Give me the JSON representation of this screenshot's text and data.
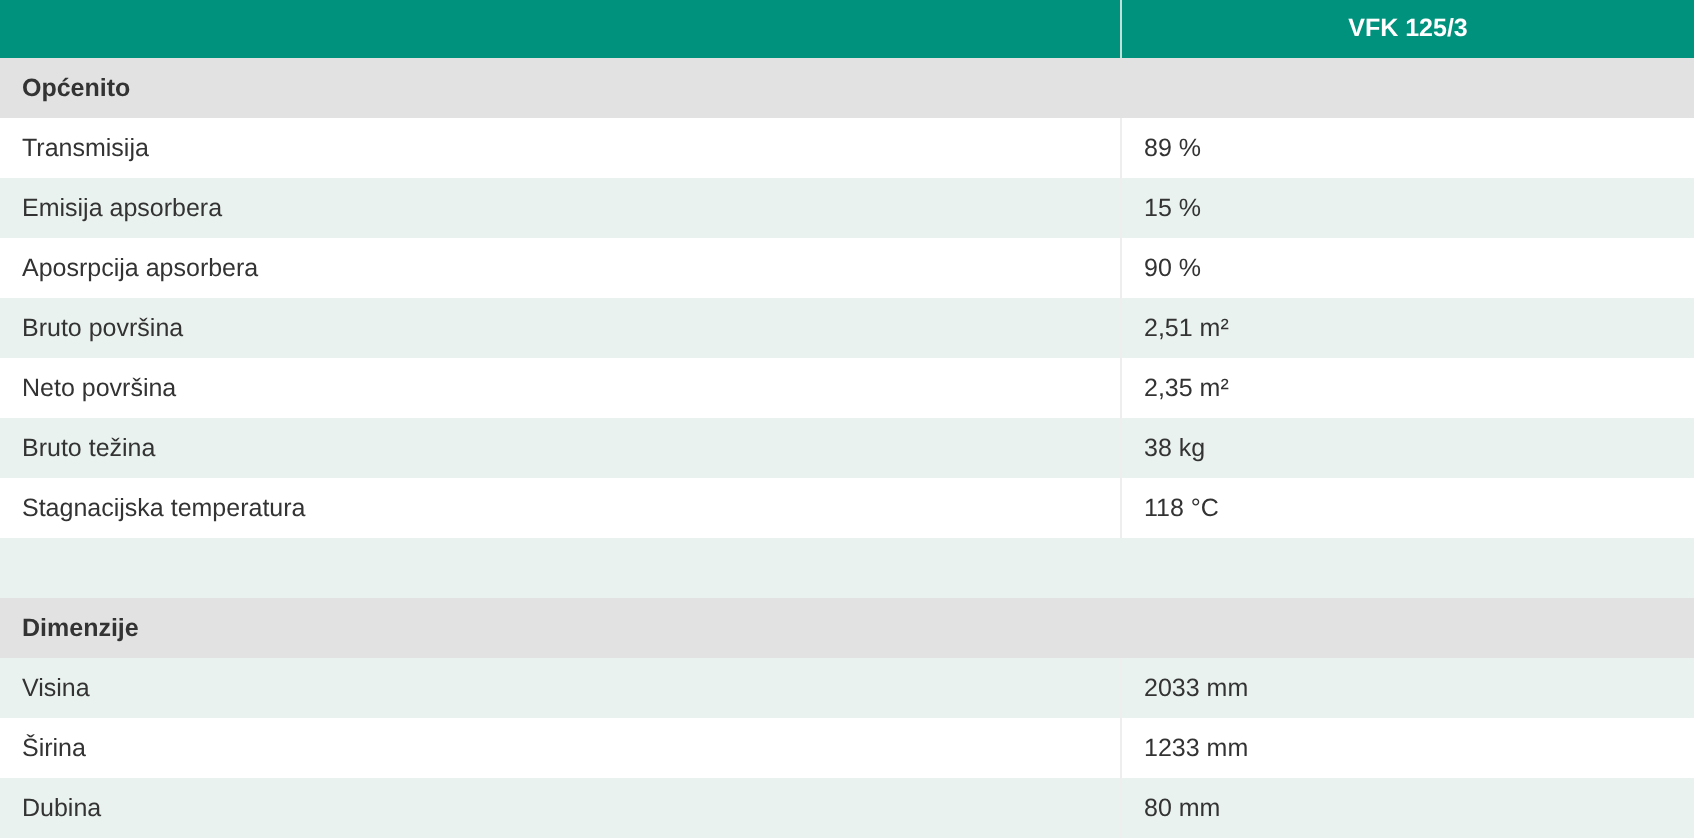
{
  "header": {
    "column_2": "VFK 125/3"
  },
  "rows": [
    {
      "kind": "section",
      "label": "Općenito"
    },
    {
      "kind": "row",
      "label": "Transmisija",
      "value": "89 %"
    },
    {
      "kind": "row",
      "label": "Emisija apsorbera",
      "value": "15 %"
    },
    {
      "kind": "row",
      "label": "Aposrpcija apsorbera",
      "value": "90 %"
    },
    {
      "kind": "row",
      "label": "Bruto površina",
      "value": "2,51 m²"
    },
    {
      "kind": "row",
      "label": "Neto površina",
      "value": "2,35 m²"
    },
    {
      "kind": "row",
      "label": "Bruto težina",
      "value": "38 kg"
    },
    {
      "kind": "row",
      "label": "Stagnacijska temperatura",
      "value": "118 °C"
    },
    {
      "kind": "spacer"
    },
    {
      "kind": "section",
      "label": "Dimenzije"
    },
    {
      "kind": "row",
      "label": "Visina",
      "value": "2033 mm"
    },
    {
      "kind": "row",
      "label": "Širina",
      "value": "1233 mm"
    },
    {
      "kind": "row",
      "label": "Dubina",
      "value": "80 mm"
    }
  ]
}
